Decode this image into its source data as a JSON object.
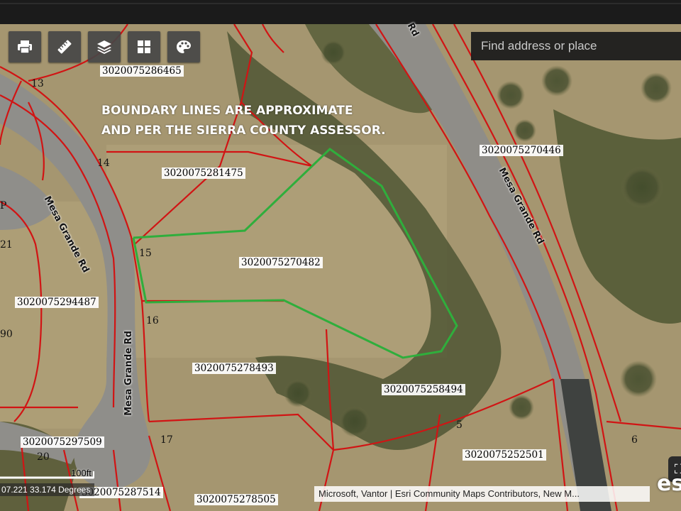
{
  "search": {
    "placeholder": "Find address or place"
  },
  "toolbar": {
    "buttons": [
      {
        "icon": "printer-icon"
      },
      {
        "icon": "measure-ruler-icon"
      },
      {
        "icon": "layers-icon"
      },
      {
        "icon": "basemap-grid-icon"
      },
      {
        "icon": "palette-icon"
      }
    ]
  },
  "notice": {
    "line1": "BOUNDARY LINES ARE APPROXIMATE",
    "line2": "AND PER THE SIERRA COUNTY ASSESSOR."
  },
  "parcels": {
    "p286465": "3020075286465",
    "p281475": "3020075281475",
    "p270446": "3020075270446",
    "p270482": "3020075270482",
    "p294487": "3020075294487",
    "p278493": "3020075278493",
    "p258494": "3020075258494",
    "p297509": "3020075297509",
    "p252501": "3020075252501",
    "p287514": "3020075287514",
    "p278505": "3020075278505"
  },
  "lots": {
    "l13": "13",
    "l14": "14",
    "l15": "15",
    "l16": "16",
    "l17": "17",
    "l5": "5",
    "l6": "6",
    "l20": "20",
    "l21": "21",
    "l90": "90",
    "lP": "P"
  },
  "roads": {
    "mesa_upper_left": "Mesa Grande Rd",
    "mesa_lower_left": "Mesa Grande Rd",
    "mesa_right": "Mesa Grande Rd",
    "rd_top": "Rd"
  },
  "scale": {
    "label": "100ft"
  },
  "coordinates": {
    "text": "07.221 33.174 Degrees"
  },
  "attribution": {
    "text": "Microsoft, Vantor | Esri Community Maps Contributors, New M..."
  },
  "logo": {
    "text": "esri"
  },
  "colors": {
    "parcel_line": "#d11414",
    "highlight_line": "#2fae3c",
    "terrain": "#a8996f",
    "road": "#8e8e8c"
  }
}
